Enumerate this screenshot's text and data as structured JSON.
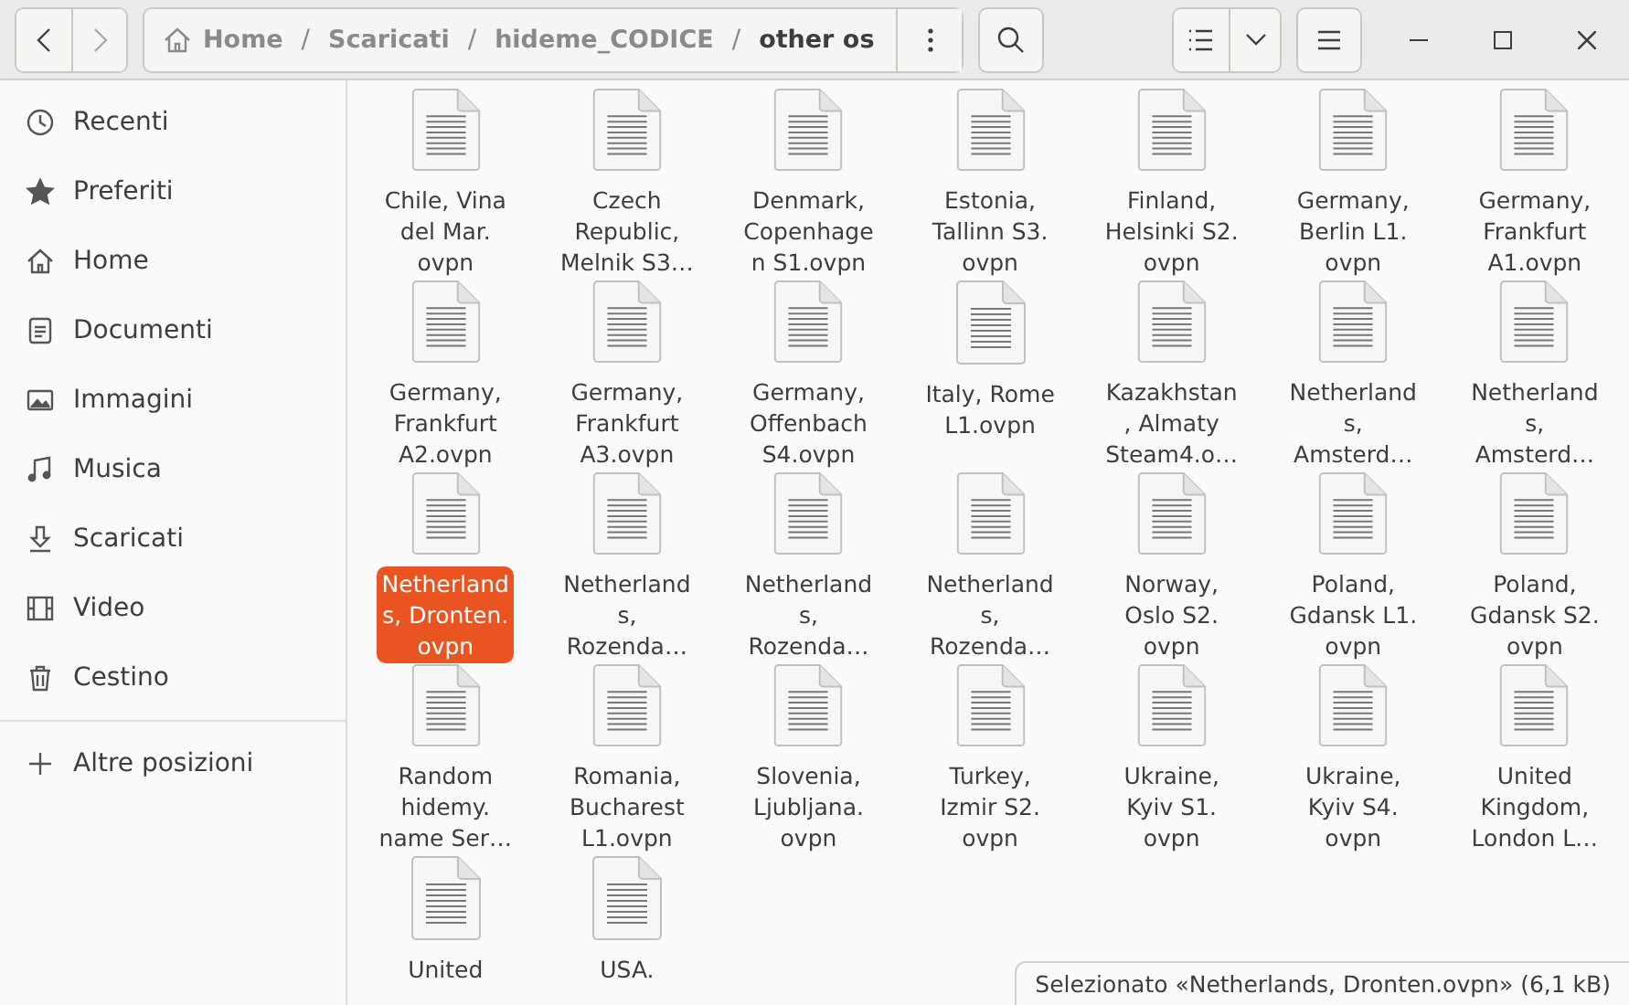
{
  "header": {
    "path": {
      "separator": "/",
      "segments": [
        {
          "label": "Home",
          "selected": false,
          "kind": "home"
        },
        {
          "label": "Scaricati",
          "selected": false,
          "kind": "folder"
        },
        {
          "label": "hideme_CODICE",
          "selected": false,
          "kind": "folder"
        },
        {
          "label": "other os",
          "selected": true,
          "kind": "folder"
        }
      ]
    }
  },
  "sidebar": {
    "items": [
      {
        "label": "Recenti",
        "kind": "recent"
      },
      {
        "label": "Preferiti",
        "kind": "star"
      },
      {
        "label": "Home",
        "kind": "home"
      },
      {
        "label": "Documenti",
        "kind": "document"
      },
      {
        "label": "Immagini",
        "kind": "image"
      },
      {
        "label": "Musica",
        "kind": "music"
      },
      {
        "label": "Scaricati",
        "kind": "download"
      },
      {
        "label": "Video",
        "kind": "video"
      },
      {
        "label": "Cestino",
        "kind": "trash"
      }
    ],
    "other": {
      "label": "Altre posizioni"
    }
  },
  "files": [
    {
      "name": "Chile, Vina\ndel Mar.\novpn",
      "selected": false
    },
    {
      "name": "Czech\nRepublic,\nMelnik S3…",
      "selected": false
    },
    {
      "name": "Denmark,\nCopenhage\nn S1.ovpn",
      "selected": false
    },
    {
      "name": "Estonia,\nTallinn S3.\novpn",
      "selected": false
    },
    {
      "name": "Finland,\nHelsinki S2.\novpn",
      "selected": false
    },
    {
      "name": "Germany,\nBerlin L1.\novpn",
      "selected": false
    },
    {
      "name": "Germany,\nFrankfurt\nA1.ovpn",
      "selected": false
    },
    {
      "name": "Germany,\nFrankfurt\nA2.ovpn",
      "selected": false
    },
    {
      "name": "Germany,\nFrankfurt\nA3.ovpn",
      "selected": false
    },
    {
      "name": "Germany,\nOffenbach\nS4.ovpn",
      "selected": false
    },
    {
      "name": "Italy, Rome\nL1.ovpn",
      "selected": false
    },
    {
      "name": "Kazakhstan\n, Almaty\nSteam4.o…",
      "selected": false
    },
    {
      "name": "Netherland\ns,\nAmsterd…",
      "selected": false
    },
    {
      "name": "Netherland\ns,\nAmsterd…",
      "selected": false
    },
    {
      "name": "Netherland\ns, Dronten.\novpn",
      "selected": true
    },
    {
      "name": "Netherland\ns,\nRozenda…",
      "selected": false
    },
    {
      "name": "Netherland\ns,\nRozenda…",
      "selected": false
    },
    {
      "name": "Netherland\ns,\nRozenda…",
      "selected": false
    },
    {
      "name": "Norway,\nOslo S2.\novpn",
      "selected": false
    },
    {
      "name": "Poland,\nGdansk L1.\novpn",
      "selected": false
    },
    {
      "name": "Poland,\nGdansk S2.\novpn",
      "selected": false
    },
    {
      "name": "Random\nhidemy.\nname Ser…",
      "selected": false
    },
    {
      "name": "Romania,\nBucharest\nL1.ovpn",
      "selected": false
    },
    {
      "name": "Slovenia,\nLjubljana.\novpn",
      "selected": false
    },
    {
      "name": "Turkey,\nIzmir S2.\novpn",
      "selected": false
    },
    {
      "name": "Ukraine,\nKyiv S1.\novpn",
      "selected": false
    },
    {
      "name": "Ukraine,\nKyiv S4.\novpn",
      "selected": false
    },
    {
      "name": "United\nKingdom,\nLondon L…",
      "selected": false
    },
    {
      "name": "United",
      "selected": false
    },
    {
      "name": "USA.",
      "selected": false
    }
  ],
  "status": "Selezionato «Netherlands, Dronten.ovpn» (6,1 kB)"
}
